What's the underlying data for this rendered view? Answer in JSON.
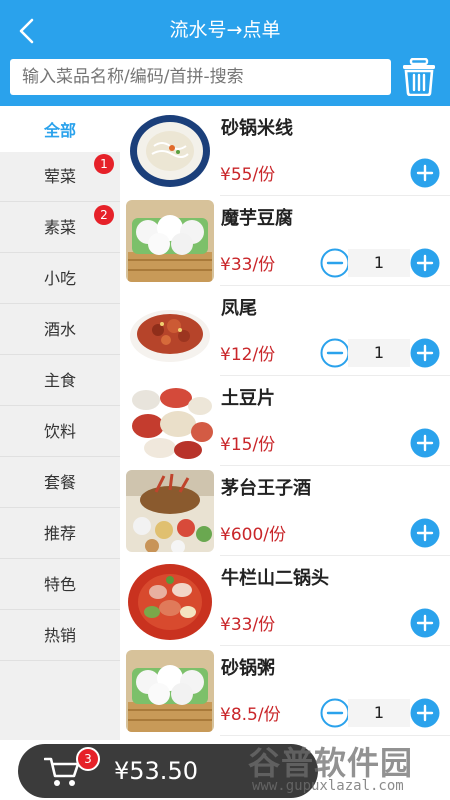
{
  "header": {
    "title": "流水号→点单",
    "back_icon": "chevron-left-icon",
    "search_placeholder": "输入菜品名称/编码/首拼-搜索",
    "trash_icon": "trash-icon",
    "color": "#2aa2ec"
  },
  "sidebar": {
    "items": [
      {
        "label": "全部",
        "active": true
      },
      {
        "label": "荤菜",
        "badge": "1"
      },
      {
        "label": "素菜",
        "badge": "2"
      },
      {
        "label": "小吃"
      },
      {
        "label": "酒水"
      },
      {
        "label": "主食"
      },
      {
        "label": "饮料"
      },
      {
        "label": "套餐"
      },
      {
        "label": "推荐"
      },
      {
        "label": "特色"
      },
      {
        "label": "热销"
      }
    ]
  },
  "dishes": [
    {
      "name": "砂锅米线",
      "price": "¥55/份",
      "qty": null
    },
    {
      "name": "魔芋豆腐",
      "price": "¥33/份",
      "qty": "1"
    },
    {
      "name": "凤尾",
      "price": "¥12/份",
      "qty": "1"
    },
    {
      "name": "土豆片",
      "price": "¥15/份",
      "qty": null
    },
    {
      "name": "茅台王子酒",
      "price": "¥600/份",
      "qty": null
    },
    {
      "name": "牛栏山二锅头",
      "price": "¥33/份",
      "qty": null
    },
    {
      "name": "砂锅粥",
      "price": "¥8.5/份",
      "qty": "1"
    }
  ],
  "cart": {
    "count": "3",
    "total": "¥53.50",
    "icon": "cart-icon"
  },
  "watermark": {
    "text": "谷普软件园",
    "url": "www.gupuxlazal.com"
  },
  "colors": {
    "accent": "#2aa2ec",
    "price": "#c9262a",
    "badge": "#e62129",
    "cartbar": "#3b3b3b"
  }
}
